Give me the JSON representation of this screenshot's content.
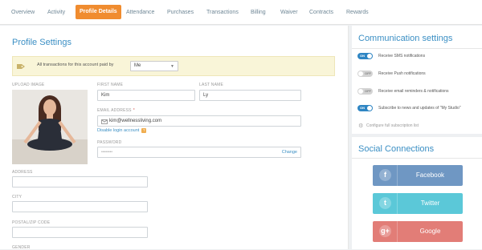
{
  "tabs": [
    "Overview",
    "Activity",
    "Profile Details",
    "Attendance",
    "Purchases",
    "Transactions",
    "Billing",
    "Waiver",
    "Contracts",
    "Rewards"
  ],
  "active_tab": "Profile Details",
  "profile": {
    "title": "Profile Settings",
    "notice": "All transactions for this account paid by",
    "paid_by": "Me",
    "upload_label": "UPLOAD IMAGE",
    "first_name_label": "FIRST NAME",
    "first_name": "Kim",
    "last_name_label": "LAST NAME",
    "last_name": "Ly",
    "email_label": "EMAIL ADDRESS",
    "required_mark": "*",
    "email": "kim@wellnessliving.com",
    "disable_login": "Disable login account",
    "help_mark": "?",
    "password_label": "PASSWORD",
    "password_mask": "••••••••",
    "change": "Change",
    "address_label": "ADDRESS",
    "address": "",
    "city_label": "CITY",
    "city": "",
    "postal_label": "POSTAL/ZIP CODE",
    "postal": "",
    "gender_label": "GENDER"
  },
  "communication": {
    "title": "Communication settings",
    "options": [
      {
        "state": "ON",
        "label": "Receive SMS notifications"
      },
      {
        "state": "OFF",
        "label": "Receive Push notifications"
      },
      {
        "state": "OFF",
        "label": "Receive email reminders & notifications"
      },
      {
        "state": "ON",
        "label": "Subscribe to news and updates of \"My Studio\""
      }
    ],
    "configure": "Configure full subscription list"
  },
  "social": {
    "title": "Social Connections",
    "facebook": {
      "icon": "f",
      "label": "Facebook",
      "color": "#6f97c3"
    },
    "twitter": {
      "icon": "t",
      "label": "Twitter",
      "color": "#5bc8d8"
    },
    "google": {
      "icon": "g+",
      "label": "Google",
      "color": "#e27d77"
    }
  },
  "colors": {
    "accent": "#f08c2f",
    "link": "#3b8fc4",
    "toggle_on": "#2e85c3"
  }
}
